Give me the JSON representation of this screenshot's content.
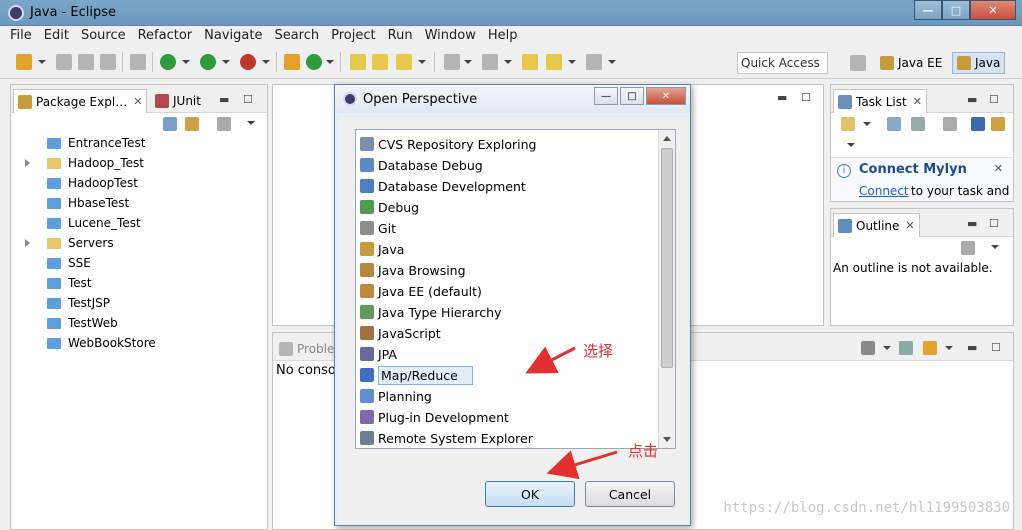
{
  "window": {
    "title": "Java - Eclipse",
    "buttons": [
      "—",
      "□",
      "✕"
    ]
  },
  "menubar": [
    "File",
    "Edit",
    "Source",
    "Refactor",
    "Navigate",
    "Search",
    "Project",
    "Run",
    "Window",
    "Help"
  ],
  "toolbar": {
    "quick_access": "Quick Access",
    "perspectives": [
      {
        "label": "Java EE",
        "icon": "java-ee-perspective-icon"
      },
      {
        "label": "Java",
        "icon": "java-perspective-icon",
        "active": true
      }
    ]
  },
  "package_explorer": {
    "tabs": [
      {
        "label": "Package Expl…",
        "icon": "package-explorer-icon",
        "closable": true
      },
      {
        "label": "JUnit",
        "icon": "junit-icon"
      }
    ],
    "projects": [
      {
        "name": "EntranceTest",
        "expandable": false,
        "open": false
      },
      {
        "name": "Hadoop_Test",
        "expandable": true,
        "open": true
      },
      {
        "name": "HadoopTest",
        "expandable": false,
        "open": false
      },
      {
        "name": "HbaseTest",
        "expandable": false,
        "open": false
      },
      {
        "name": "Lucene_Test",
        "expandable": false,
        "open": false
      },
      {
        "name": "Servers",
        "expandable": true,
        "open": true
      },
      {
        "name": "SSE",
        "expandable": false,
        "open": false
      },
      {
        "name": "Test",
        "expandable": false,
        "open": false
      },
      {
        "name": "TestJSP",
        "expandable": false,
        "open": false
      },
      {
        "name": "TestWeb",
        "expandable": false,
        "open": false
      },
      {
        "name": "WebBookStore",
        "expandable": false,
        "open": false
      }
    ]
  },
  "problems_view": {
    "tab_label": "Proble",
    "content": "No conso"
  },
  "task_list": {
    "tab_label": "Task List",
    "mylyn": {
      "title": "Connect Mylyn",
      "link": "Connect",
      "rest": "to your task and"
    }
  },
  "outline": {
    "tab_label": "Outline",
    "message": "An outline is not available."
  },
  "dialog": {
    "title": "Open Perspective",
    "perspectives": [
      {
        "label": "CVS Repository Exploring",
        "icon": "cvs-icon",
        "color": "#7a8fa8"
      },
      {
        "label": "Database Debug",
        "icon": "database-debug-icon",
        "color": "#5a8bc2"
      },
      {
        "label": "Database Development",
        "icon": "database-development-icon",
        "color": "#4b7fc0"
      },
      {
        "label": "Debug",
        "icon": "debug-bug-icon",
        "color": "#4f9b4f"
      },
      {
        "label": "Git",
        "icon": "git-icon",
        "color": "#8d8d8d"
      },
      {
        "label": "Java",
        "icon": "java-icon",
        "color": "#c79a3a"
      },
      {
        "label": "Java Browsing",
        "icon": "java-browsing-icon",
        "color": "#b08a3a"
      },
      {
        "label": "Java EE (default)",
        "icon": "java-ee-icon",
        "color": "#c0883a"
      },
      {
        "label": "Java Type Hierarchy",
        "icon": "type-hierarchy-icon",
        "color": "#5d9b5d"
      },
      {
        "label": "JavaScript",
        "icon": "javascript-icon",
        "color": "#a07040"
      },
      {
        "label": "JPA",
        "icon": "jpa-icon",
        "color": "#6a6a9a"
      },
      {
        "label": "Map/Reduce",
        "icon": "hadoop-elephant-icon",
        "color": "#3f6fc4",
        "selected": true
      },
      {
        "label": "Planning",
        "icon": "planning-icon",
        "color": "#5e8fd0"
      },
      {
        "label": "Plug-in Development",
        "icon": "plugin-icon",
        "color": "#7a6aa8"
      },
      {
        "label": "Remote System Explorer",
        "icon": "remote-system-icon",
        "color": "#6e7f90"
      }
    ],
    "ok_label": "OK",
    "cancel_label": "Cancel"
  },
  "annotations": {
    "select": "选择",
    "click": "点击"
  },
  "watermark": "https://blog.csdn.net/hl1199503830",
  "colors": {
    "annotation": "#e03030",
    "selection": "#e3eefb",
    "titlebar": "#7aa6c9"
  }
}
